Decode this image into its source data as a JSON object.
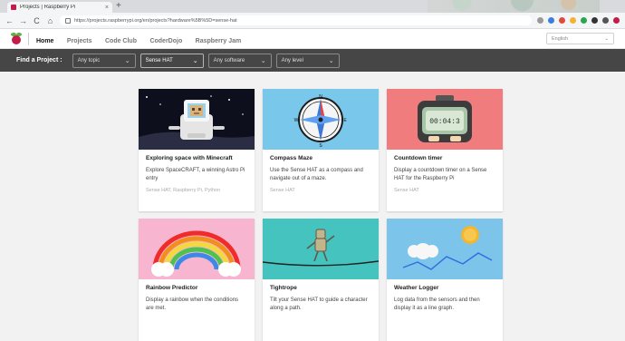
{
  "browser": {
    "tab_title": "Projects | Raspberry Pi",
    "tab_close": "×",
    "new_tab": "+",
    "back": "←",
    "forward": "→",
    "reload": "C",
    "home": "⌂",
    "url": "https://projects.raspberrypi.org/en/projects?hardware%5B%5D=sense-hat"
  },
  "site": {
    "nav": [
      "Home",
      "Projects",
      "Code Club",
      "CoderDojo",
      "Raspberry Jam"
    ],
    "language": "English",
    "language_chevron": "⌄"
  },
  "filters": {
    "label": "Find a Project :",
    "items": [
      {
        "label": "Any topic",
        "chevron": "⌄"
      },
      {
        "label": "Sense HAT",
        "chevron": "⌄"
      },
      {
        "label": "Any software",
        "chevron": "⌄"
      },
      {
        "label": "Any level",
        "chevron": "⌄"
      }
    ]
  },
  "projects": [
    {
      "title": "Exploring space with Minecraft",
      "description": "Explore SpaceCRAFT, a winning Astro Pi entry",
      "tags": "Sense HAT, Raspberry Pi, Python"
    },
    {
      "title": "Compass Maze",
      "description": "Use the Sense HAT as a compass and navigate out of a maze.",
      "tags": "Sense HAT"
    },
    {
      "title": "Countdown timer",
      "description": "Display a countdown timer on a Sense HAT for the Raspberry Pi",
      "tags": "Sense HAT",
      "timer_text": "00:04:3"
    },
    {
      "title": "Rainbow Predictor",
      "description": "Display a rainbow when the conditions are met."
    },
    {
      "title": "Tightrope",
      "description": "Tilt your Sense HAT to guide a character along a path."
    },
    {
      "title": "Weather Logger",
      "description": "Log data from the sensors and then display it as a line graph."
    }
  ],
  "colors": {
    "raspberry": "#c51a4a",
    "filterbar": "#464646",
    "page_bg": "#f2f2f2"
  },
  "icons": [
    "raspberry-pi-logo",
    "lock-icon",
    "chevron-down-icon",
    "star-icon",
    "extension-icon"
  ]
}
